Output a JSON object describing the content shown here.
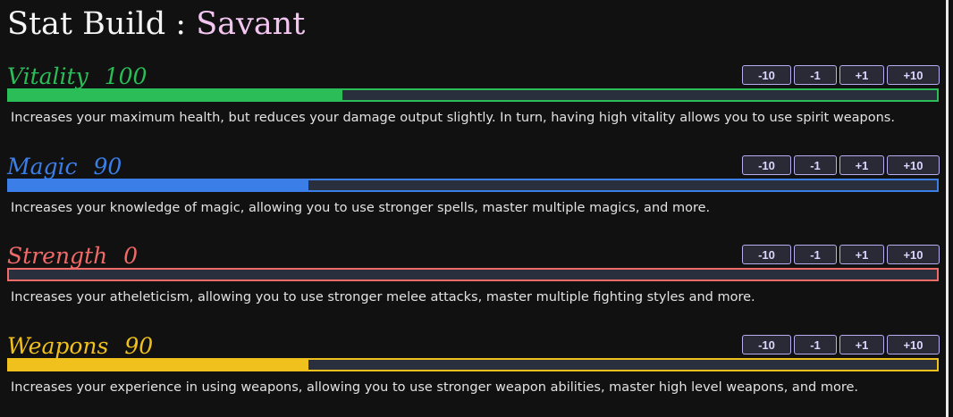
{
  "header": {
    "title_prefix": "Stat Build : ",
    "build_name": "Savant"
  },
  "buttons": {
    "minus10": "-10",
    "minus1": "-1",
    "plus1": "+1",
    "plus10": "+10"
  },
  "stats": [
    {
      "name": "Vitality",
      "value": "100",
      "fill_fraction": 0.359,
      "color": "#2bbd57",
      "description": "Increases your maximum health, but reduces your damage output slightly. In turn, having high vitality allows you to use spirit weapons."
    },
    {
      "name": "Magic",
      "value": "90",
      "fill_fraction": 0.323,
      "color": "#3b7ee8",
      "description": "Increases your knowledge of magic, allowing you to use stronger spells, master multiple magics, and more."
    },
    {
      "name": "Strength",
      "value": "0",
      "fill_fraction": 0.0,
      "color": "#f06a68",
      "description": "Increases your atheleticism, allowing you to use stronger melee attacks, master multiple fighting styles and more."
    },
    {
      "name": "Weapons",
      "value": "90",
      "fill_fraction": 0.323,
      "color": "#f0c01c",
      "description": "Increases your experience in using weapons, allowing you to use stronger weapon abilities, master high level weapons, and more."
    }
  ]
}
